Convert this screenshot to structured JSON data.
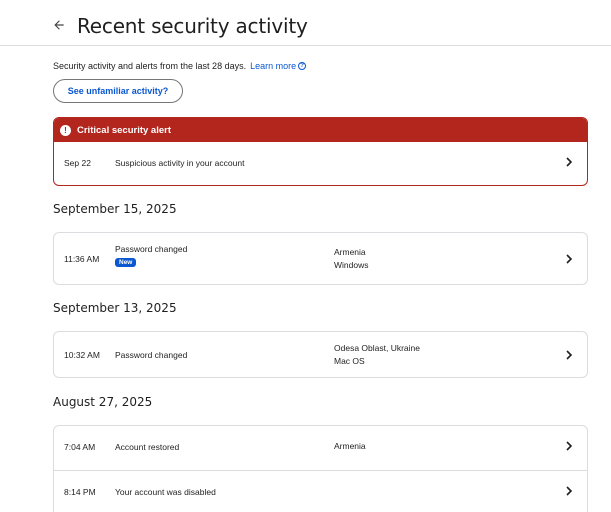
{
  "header": {
    "title": "Recent security activity",
    "back_icon": "arrow-back-icon"
  },
  "intro": {
    "text": "Security activity and alerts from the last 28 days.",
    "learn_more": "Learn more",
    "help_icon": "help-circle-icon"
  },
  "unfamiliar_button": {
    "label": "See unfamiliar activity?"
  },
  "critical_alert": {
    "title": "Critical security alert",
    "icon": "alert-circle-icon",
    "date": "Sep 22",
    "text": "Suspicious activity in your account",
    "color": "#b3261e"
  },
  "groups": [
    {
      "date": "September 15, 2025",
      "events": [
        {
          "time": "11:36 AM",
          "event": "Password changed",
          "badge": "New",
          "location": "Armenia",
          "device": "Windows"
        }
      ]
    },
    {
      "date": "September 13, 2025",
      "events": [
        {
          "time": "10:32 AM",
          "event": "Password changed",
          "location": "Odesa Oblast, Ukraine",
          "device": "Mac OS"
        }
      ]
    },
    {
      "date": "August 27, 2025",
      "events": [
        {
          "time": "7:04 AM",
          "event": "Account restored",
          "location": "Armenia"
        },
        {
          "time": "8:14 PM",
          "event": "Your account was disabled"
        }
      ]
    }
  ],
  "accent_color": "#0b57d0"
}
